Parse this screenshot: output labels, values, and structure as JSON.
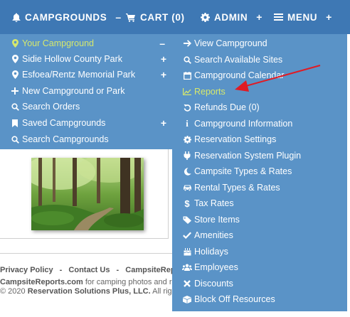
{
  "topnav": {
    "campgrounds": {
      "label": "CAMPGROUNDS",
      "icon": "bell-icon",
      "suffix": "–"
    },
    "cart": {
      "label": "CART (0)",
      "icon": "cart-icon"
    },
    "admin": {
      "label": "ADMIN",
      "icon": "gear-icon",
      "suffix": "+"
    },
    "menu": {
      "label": "MENU",
      "icon": "hamburger-icon",
      "suffix": "+"
    }
  },
  "left_menu": {
    "items": [
      {
        "label": "Your Campground",
        "icon": "map-marker-icon",
        "active": true,
        "control": "–"
      },
      {
        "label": "Sidie Hollow County Park",
        "icon": "map-marker-icon",
        "control": "+"
      },
      {
        "label": "Esfoea/Rentz Memorial Park",
        "icon": "map-marker-icon",
        "control": "+"
      },
      {
        "label": "New Campground or Park",
        "icon": "plus-icon"
      },
      {
        "label": "Search Orders",
        "icon": "search-icon"
      },
      {
        "label": "Saved Campgrounds",
        "icon": "bookmark-icon",
        "control": "+"
      },
      {
        "label": "Search Campgrounds",
        "icon": "search-icon"
      }
    ]
  },
  "right_menu": {
    "items": [
      {
        "label": "View Campground",
        "icon": "arrow-right-icon"
      },
      {
        "label": "Search Available Sites",
        "icon": "search-icon"
      },
      {
        "label": "Campground Calendar",
        "icon": "calendar-icon"
      },
      {
        "label": "Reports",
        "icon": "chart-icon",
        "active": true
      },
      {
        "label": "Refunds Due (0)",
        "icon": "undo-icon"
      },
      {
        "label": "Campground Information",
        "icon": "info-icon"
      },
      {
        "label": "Reservation Settings",
        "icon": "gear-icon"
      },
      {
        "label": "Reservation System Plugin",
        "icon": "plug-icon"
      },
      {
        "label": "Campsite Types & Rates",
        "icon": "moon-icon"
      },
      {
        "label": "Rental Types & Rates",
        "icon": "car-icon"
      },
      {
        "label": "Tax Rates",
        "icon": "dollar-icon"
      },
      {
        "label": "Store Items",
        "icon": "tag-icon"
      },
      {
        "label": "Amenities",
        "icon": "check-icon"
      },
      {
        "label": "Holidays",
        "icon": "birthday-cake-icon"
      },
      {
        "label": "Employees",
        "icon": "users-icon"
      },
      {
        "label": "Discounts",
        "icon": "close-icon"
      },
      {
        "label": "Block Off Resources",
        "icon": "block-icon"
      }
    ]
  },
  "footer": {
    "links": [
      "Privacy Policy",
      "-",
      "Contact Us",
      "-",
      "CampsiteRepor"
    ],
    "desc_site": "CampsiteReports.com",
    "desc_text": " for camping photos and re",
    "copy_prefix": "© 2020 ",
    "copy_company": "Reservation Solutions Plus, LLC.",
    "copy_suffix": " All rig"
  },
  "colors": {
    "topbar": "#3e78b4",
    "menu": "#5a93c7",
    "active_text": "#d6e86c",
    "arrow": "#e01b24"
  }
}
